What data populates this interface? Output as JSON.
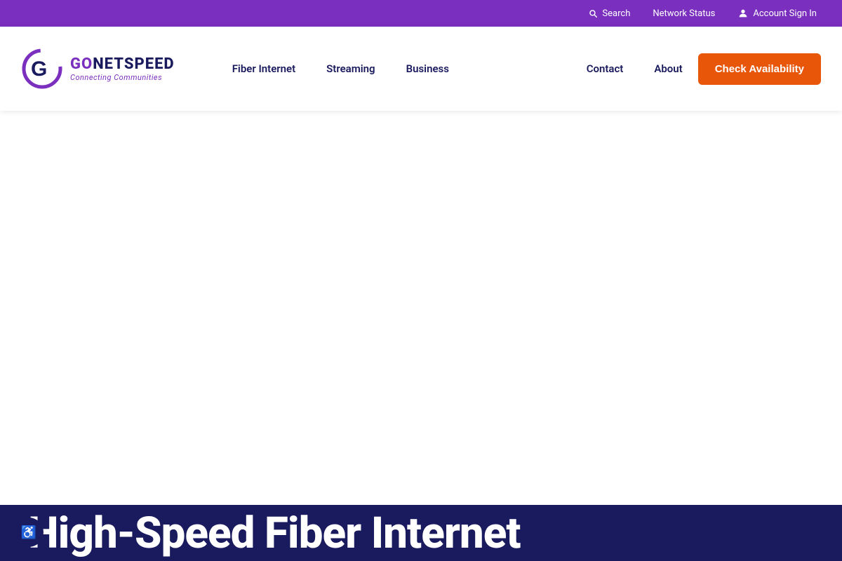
{
  "utility_bar": {
    "search_label": "Search",
    "network_status_label": "Network Status",
    "account_sign_in_label": "Account Sign In"
  },
  "nav": {
    "logo_go": "GO",
    "logo_netspeed": "NETSPEED",
    "logo_tagline": "Connecting Communities",
    "links": [
      {
        "id": "fiber-internet",
        "label": "Fiber Internet"
      },
      {
        "id": "streaming",
        "label": "Streaming"
      },
      {
        "id": "business",
        "label": "Business"
      },
      {
        "id": "contact",
        "label": "Contact"
      },
      {
        "id": "about",
        "label": "About"
      }
    ],
    "cta_label": "Check Availability"
  },
  "hero": {
    "title": "High-Speed Fiber Internet"
  },
  "accessibility": {
    "icon": "♿"
  },
  "colors": {
    "purple": "#7b2fbe",
    "dark_navy": "#1a1a5e",
    "orange": "#e8560a",
    "white": "#ffffff"
  }
}
